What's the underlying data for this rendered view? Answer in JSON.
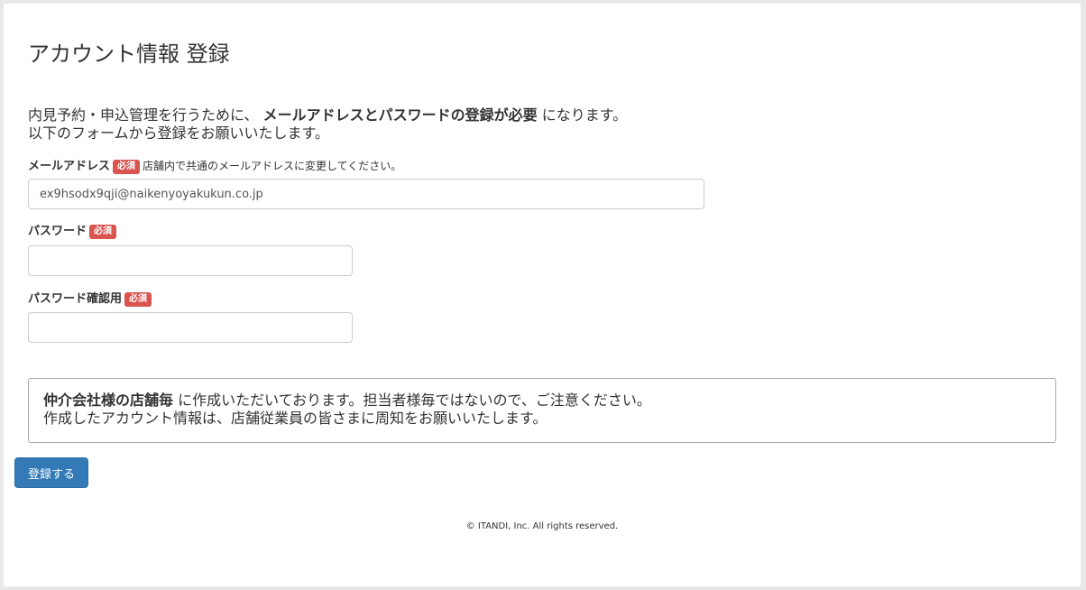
{
  "page": {
    "title": "アカウント情報 登録"
  },
  "intro": {
    "line1_before": "内見予約・申込管理を行うために、",
    "line1_bold": "メールアドレスとパスワードの登録が必要",
    "line1_after": "になります。",
    "line2": "以下のフォームから登録をお願いいたします。"
  },
  "form": {
    "required_badge": "必須",
    "email": {
      "label": "メールアドレス",
      "hint": "店舗内で共通のメールアドレスに変更してください。",
      "value": "ex9hsodx9qji@naikenyoyakukun.co.jp"
    },
    "password": {
      "label": "パスワード",
      "value": ""
    },
    "password_confirm": {
      "label": "パスワード確認用",
      "value": ""
    },
    "submit_label": "登録する"
  },
  "notice": {
    "line1_bold": "仲介会社様の店舗毎",
    "line1_after": "に作成いただいております。担当者様毎ではないので、ご注意ください。",
    "line2": "作成したアカウント情報は、店舗従業員の皆さまに周知をお願いいたします。"
  },
  "footer": {
    "copyright": "© ITANDI, Inc. All rights reserved."
  }
}
